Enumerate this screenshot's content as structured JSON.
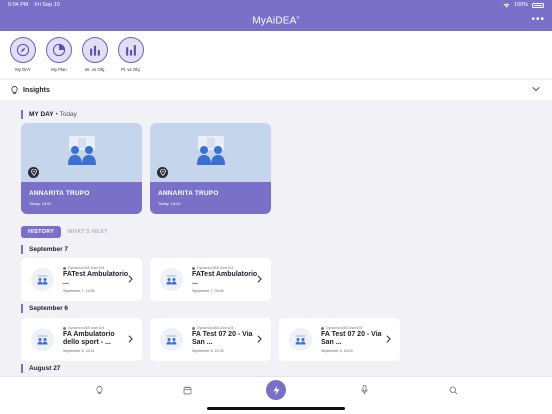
{
  "status": {
    "time": "5:04 PM",
    "date": "Fri Sep 10",
    "battery": "100%"
  },
  "app": {
    "brand": "MyAiDEA",
    "brand_mark": "®"
  },
  "quick_actions": [
    {
      "label": "My DAY",
      "icon": "compass-icon"
    },
    {
      "label": "My Plan",
      "icon": "pie-chart-icon"
    },
    {
      "label": "Int. vs Obj.",
      "icon": "bar-chart-icon"
    },
    {
      "label": "Pl. vs Obj.",
      "icon": "bar-chart-icon"
    }
  ],
  "insights": {
    "title": "Insights"
  },
  "my_day": {
    "title": "MY DAY",
    "subtitle": "• Today",
    "cards": [
      {
        "name": "ANNARITA TRUPO",
        "date": "Today, 18:51"
      },
      {
        "name": "ANNARITA TRUPO",
        "date": "Today, 18:24"
      }
    ]
  },
  "tabs": {
    "history": "HISTORY",
    "whats_next": "WHAT'S NEXT"
  },
  "history": [
    {
      "date": "September 7",
      "items": [
        {
          "owner": "Dynamics365 User104",
          "title": "FATest Ambulatorio ...",
          "date": "September 7, 14:54"
        },
        {
          "owner": "Dynamics365 User104",
          "title": "FATest Ambulatorio ...",
          "date": "September 7, 09:46"
        }
      ]
    },
    {
      "date": "September 6",
      "items": [
        {
          "owner": "Dynamics365 User104",
          "title": "FA Ambulatorio dello sport - ...",
          "date": "September 6, 22:11"
        },
        {
          "owner": "Dynamics365 User104",
          "title": "FA Test 07 20 - Via San ...",
          "date": "September 6, 21:05"
        },
        {
          "owner": "Dynamics365 User104",
          "title": "FA Test 07 20 - Via San ...",
          "date": "September 6, 18:03"
        }
      ]
    },
    {
      "date": "August 27",
      "items": []
    }
  ],
  "colors": {
    "accent": "#7a70c8",
    "accent_light": "#e1dff4",
    "card_image_bg": "#c4d5ec",
    "background": "#f2f1f6"
  }
}
